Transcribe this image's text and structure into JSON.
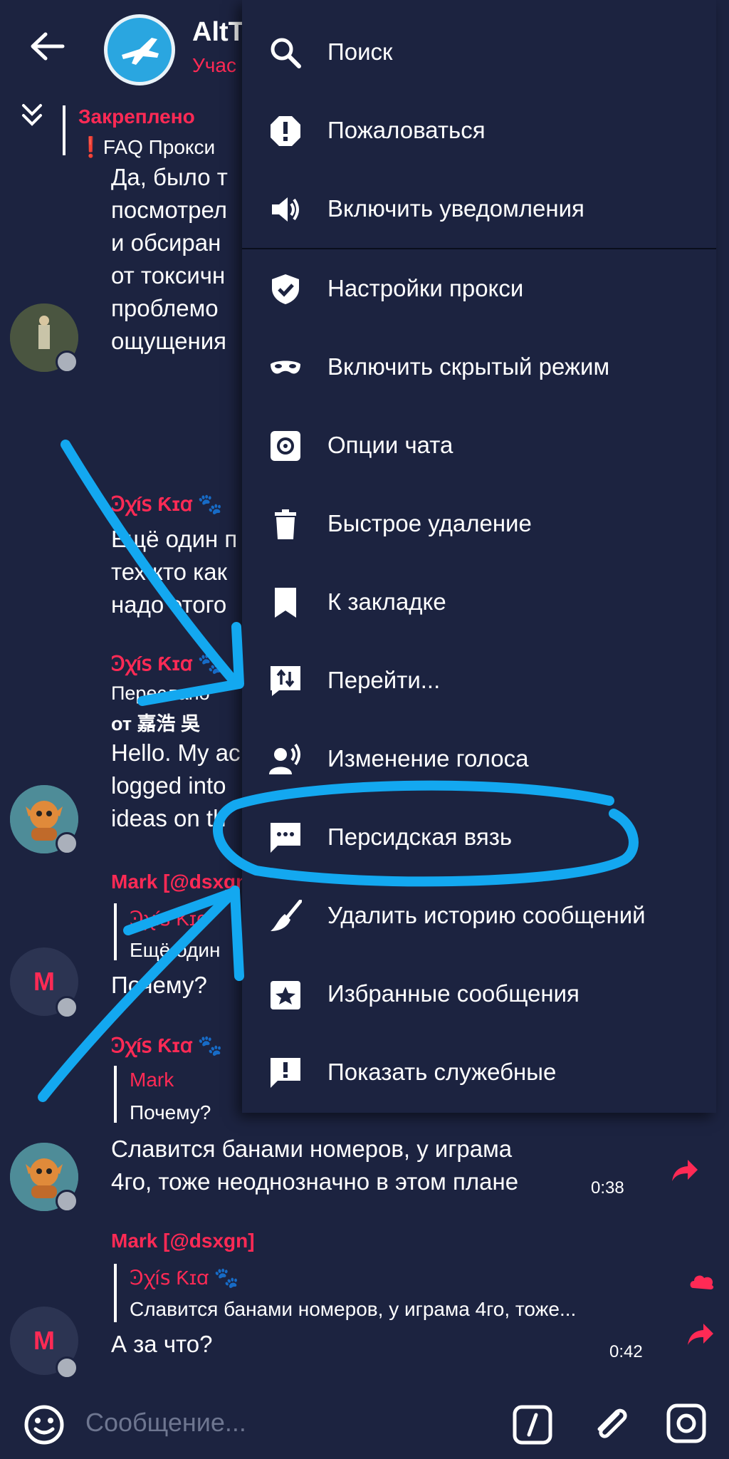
{
  "header": {
    "title": "AltT",
    "subtitle": "Учас"
  },
  "pinned": {
    "label": "Закреплено",
    "text": "❗FAQ  Прокси"
  },
  "messages": {
    "m1_lines": [
      "Да, было т",
      "посмотрел",
      "и обсиран",
      "от токсичн",
      "проблемо",
      "ощущения"
    ],
    "m2_sender": "Ꜿꭓíꜱ Ƙɪꭤ 🐾",
    "m2_lines": [
      "Ещё один п",
      "тех кто как",
      "надо этого"
    ],
    "m3_sender": "Ꜿꭓíꜱ Ƙɪꭤ 🐾",
    "m3_fwd_label": "Переслано",
    "m3_fwd_from": "от 嘉浩 吳",
    "m3_lines": [
      "Hello. My ac",
      "logged into",
      "ideas on th"
    ],
    "m4_sender": "Mark [@dsxgn",
    "m4_quote_name": "Ꜿꭓíꜱ Ƙɪꭤ",
    "m4_quote_text": "Ещё один",
    "m4_text": "Почему?",
    "m5_sender": "Ꜿꭓíꜱ Ƙɪꭤ 🐾",
    "m5_quote_name": "Mark",
    "m5_quote_text": "Почему?",
    "m5_lines": [
      "Славится банами номеров, у играма",
      "4го, тоже неоднозначно в этом плане"
    ],
    "m5_time": "0:38",
    "m6_sender": "Mark [@dsxgn]",
    "m6_quote_name": "Ꜿꭓíꜱ Ƙɪꭤ 🐾",
    "m6_quote_text": "Славится банами номеров, у играма 4го, тоже...",
    "m6_text": "А за что?",
    "m6_time": "0:42",
    "avatar_letter": "M"
  },
  "menu": {
    "items": [
      {
        "label": "Поиск",
        "icon": "search-icon"
      },
      {
        "label": "Пожаловаться",
        "icon": "report-icon"
      },
      {
        "label": "Включить уведомления",
        "icon": "volume-icon"
      },
      {
        "label": "Настройки прокси",
        "icon": "shield-icon"
      },
      {
        "label": "Включить скрытый режим",
        "icon": "mask-icon"
      },
      {
        "label": "Опции чата",
        "icon": "gear-icon"
      },
      {
        "label": "Быстрое удаление",
        "icon": "trash-icon"
      },
      {
        "label": "К закладке",
        "icon": "bookmark-icon"
      },
      {
        "label": "Перейти...",
        "icon": "jump-icon"
      },
      {
        "label": "Изменение голоса",
        "icon": "voice-icon"
      },
      {
        "label": "Персидская вязь",
        "icon": "chat-dots-icon"
      },
      {
        "label": "Удалить историю сообщений",
        "icon": "broom-icon"
      },
      {
        "label": "Избранные сообщения",
        "icon": "star-box-icon"
      },
      {
        "label": "Показать служебные",
        "icon": "alert-chat-icon"
      }
    ]
  },
  "composer": {
    "placeholder": "Сообщение..."
  },
  "colors": {
    "background": "#1c2340",
    "accent_red": "#ff2a55",
    "annotation_blue": "#13a8f0"
  }
}
